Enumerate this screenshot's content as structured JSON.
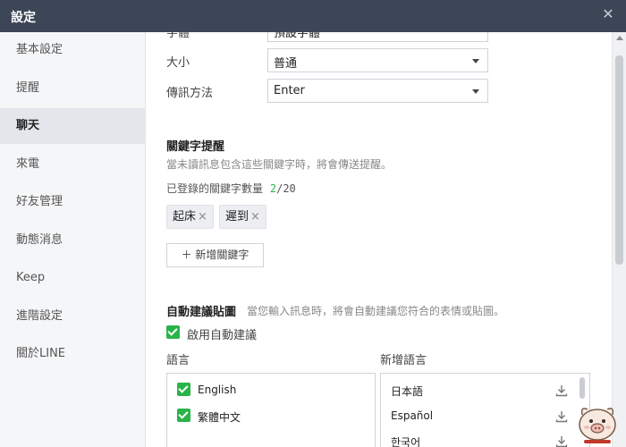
{
  "window": {
    "title": "設定",
    "close_symbol": "✕"
  },
  "sidebar": {
    "items": [
      {
        "label": "基本設定"
      },
      {
        "label": "提醒"
      },
      {
        "label": "聊天",
        "active": true
      },
      {
        "label": "來電"
      },
      {
        "label": "好友管理"
      },
      {
        "label": "動態消息"
      },
      {
        "label": "Keep"
      },
      {
        "label": "進階設定"
      },
      {
        "label": "關於LINE"
      }
    ]
  },
  "chat_settings": {
    "font_label": "字體",
    "font_value": "預設字體",
    "size_label": "大小",
    "size_value": "普通",
    "send_method_label": "傳訊方法",
    "send_method_value": "Enter"
  },
  "keyword_alert": {
    "title": "關鍵字提醒",
    "description": "當未讀訊息包含這些關鍵字時，將會傳送提醒。",
    "count_label": "已登錄的關鍵字數量",
    "count_current": "2",
    "count_separator": "/",
    "count_max": "20",
    "tags": [
      "起床",
      "遲到"
    ],
    "tag_remove_symbol": "×",
    "add_button": "＋ 新增關鍵字"
  },
  "sticker_suggest": {
    "title": "自動建議貼圖",
    "description": "當您輸入訊息時，將會自動建議您符合的表情或貼圖。",
    "enable_label": "啟用自動建議",
    "enabled": true,
    "language_header": "語言",
    "add_language_header": "新增語言",
    "languages": [
      {
        "name": "English",
        "checked": true
      },
      {
        "name": "繁體中文",
        "checked": true
      }
    ],
    "available_languages": [
      {
        "name": "日本語"
      },
      {
        "name": "Español"
      },
      {
        "name": "한국어"
      }
    ]
  },
  "colors": {
    "titlebar": "#3d4657",
    "accent_green": "#2ab34a",
    "sidebar_bg": "#f5f6f8",
    "sidebar_active": "#e3e6eb"
  },
  "icons": {
    "close": "close-icon",
    "dropdown": "chevron-down-icon",
    "download": "download-icon",
    "checkbox": "checkbox-checked-icon"
  }
}
